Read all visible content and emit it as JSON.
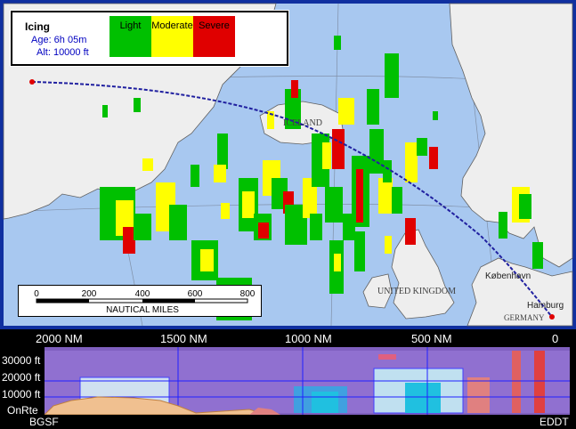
{
  "legend": {
    "title": "Icing",
    "age": "Age: 6h 05m",
    "altitude": "Alt: 10000 ft",
    "categories": [
      {
        "label": "Light",
        "color": "#00c000"
      },
      {
        "label": "Moderate",
        "color": "#ffff00"
      },
      {
        "label": "Severe",
        "color": "#e00000"
      }
    ]
  },
  "map": {
    "place_labels": [
      "ICELAND",
      "UNITED KINGDOM",
      "København",
      "Hamburg",
      "GERMANY"
    ],
    "colors": {
      "sea": "#a8c8f0",
      "land": "#eeeeee",
      "route": "#2020a0"
    }
  },
  "scale_bar": {
    "ticks": [
      "0",
      "200",
      "400",
      "600",
      "800"
    ],
    "unit": "NAUTICAL MILES"
  },
  "profile": {
    "distance_labels": [
      "2000 NM",
      "1500 NM",
      "1000 NM",
      "500 NM",
      "0"
    ],
    "altitude_labels": [
      "30000 ft",
      "20000 ft",
      "10000 ft",
      "OnRte"
    ],
    "origin": "BGSF",
    "destination": "EDDT"
  }
}
